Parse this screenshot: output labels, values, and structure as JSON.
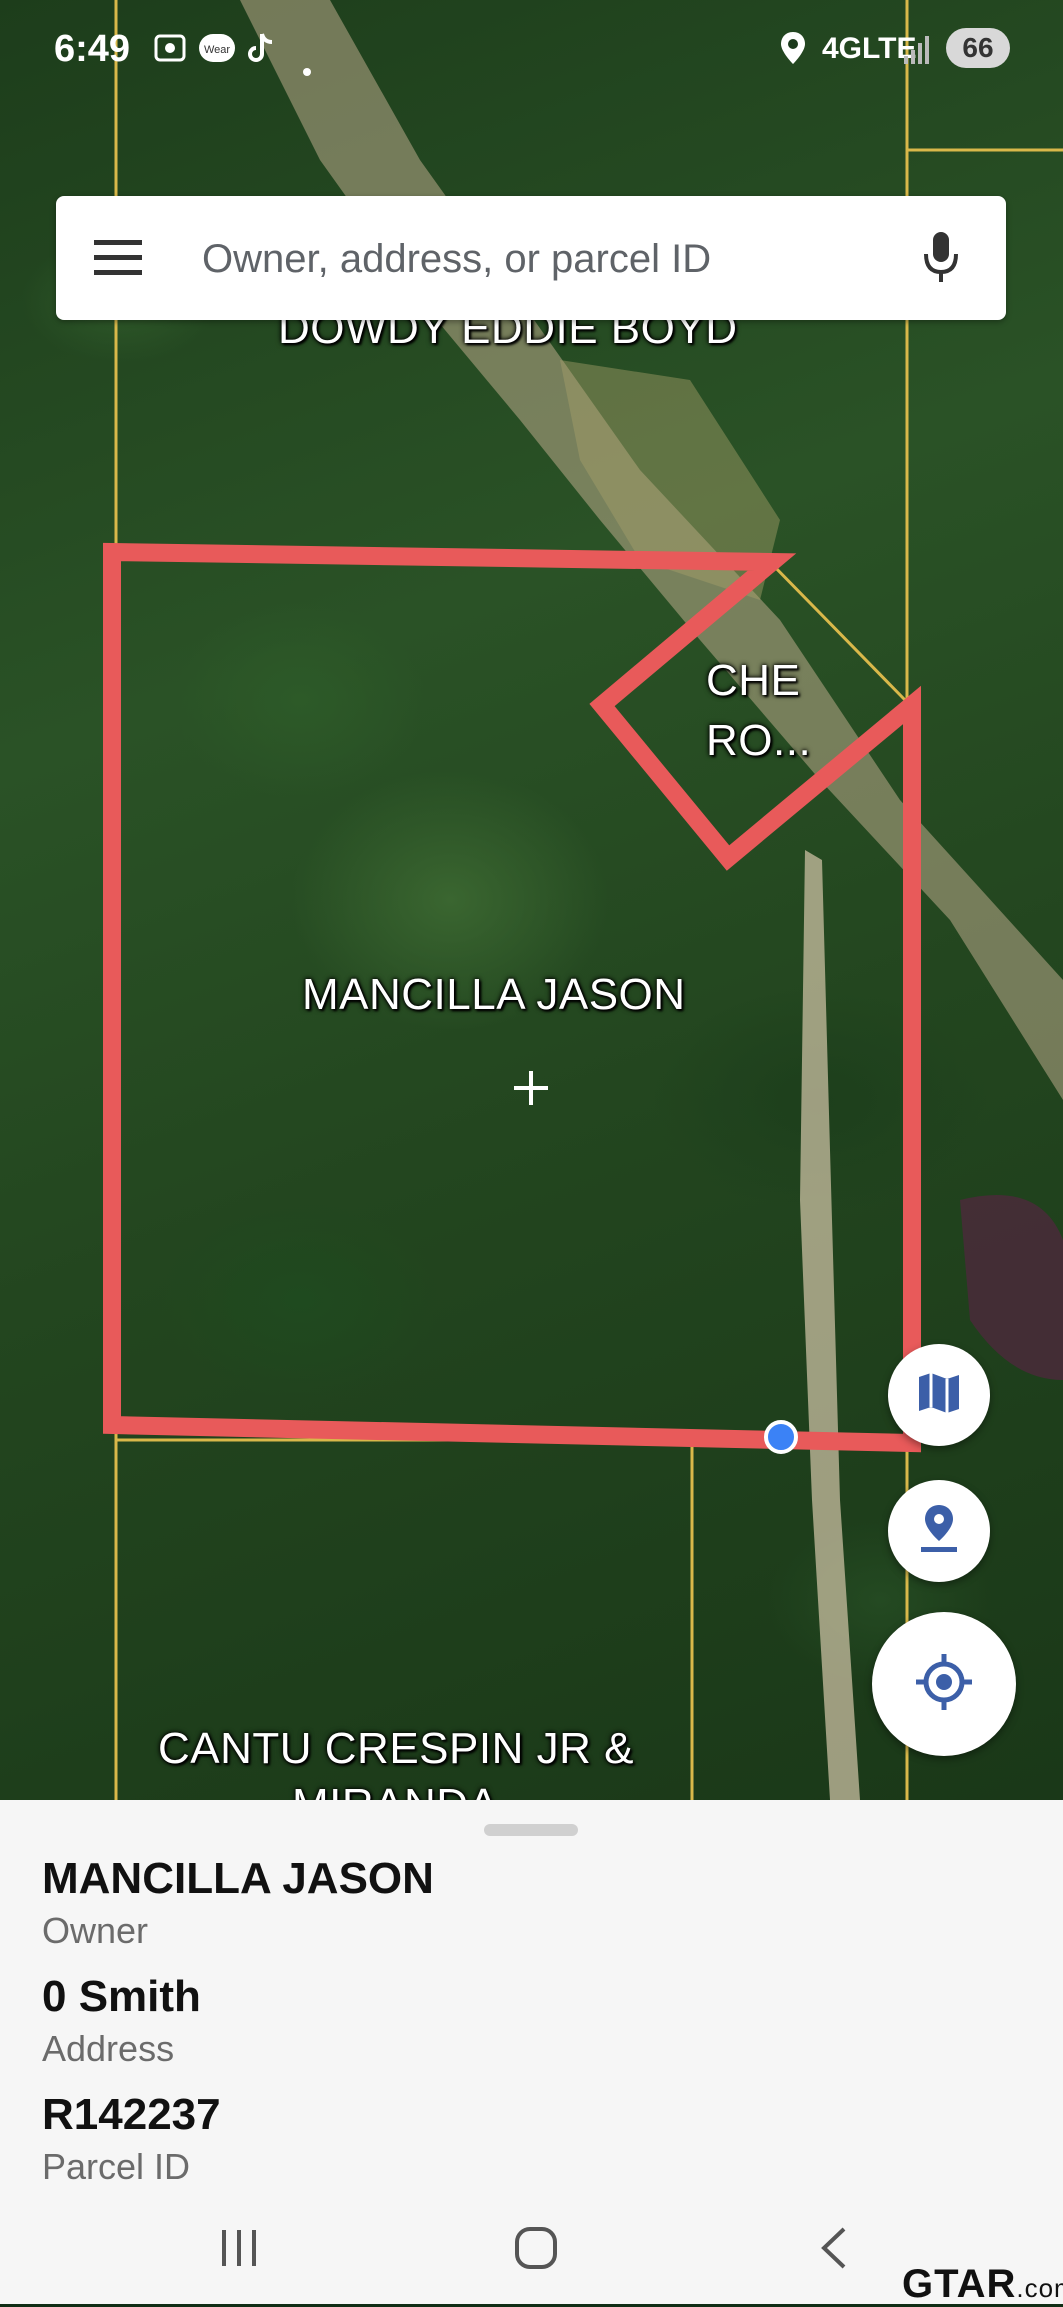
{
  "status_bar": {
    "time": "6:49",
    "network": "4GLTE",
    "battery": "66",
    "icons": [
      "screenshot-icon",
      "wear-icon",
      "tiktok-icon",
      "dot-icon",
      "location-icon",
      "signal-icon"
    ],
    "wear_label": "Wear"
  },
  "search": {
    "placeholder": "Owner, address, or parcel ID",
    "menu_icon": "hamburger-menu-icon",
    "mic_icon": "microphone-icon"
  },
  "map": {
    "labels": {
      "north_owner": "DOWDY EDDIE BOYD",
      "selected_owner": "MANCILLA JASON",
      "east_label_line1": "CHE",
      "east_label_line2": "RO...",
      "south_owner_line1": "CANTU CRESPIN JR &",
      "south_owner_line2": "MIRANDA"
    },
    "parcel_outline_color": "#e85a5a",
    "parcel_line_color": "#d9b84a",
    "center_marker_icon": "crosshair-plus-icon",
    "location_dot_color": "#3b82f6",
    "buttons": {
      "layers_icon": "map-layers-icon",
      "pin_icon": "drop-pin-icon",
      "locate_icon": "my-location-icon"
    }
  },
  "details": {
    "owner_value": "MANCILLA JASON",
    "owner_label": "Owner",
    "address_value": "0 Smith",
    "address_label": "Address",
    "parcel_value": "R142237",
    "parcel_label": "Parcel ID"
  },
  "nav_bar": {
    "recents_icon": "recents-icon",
    "home_icon": "home-icon",
    "back_icon": "back-icon"
  },
  "watermark": {
    "brand": "GTAR",
    "suffix": ".com"
  }
}
